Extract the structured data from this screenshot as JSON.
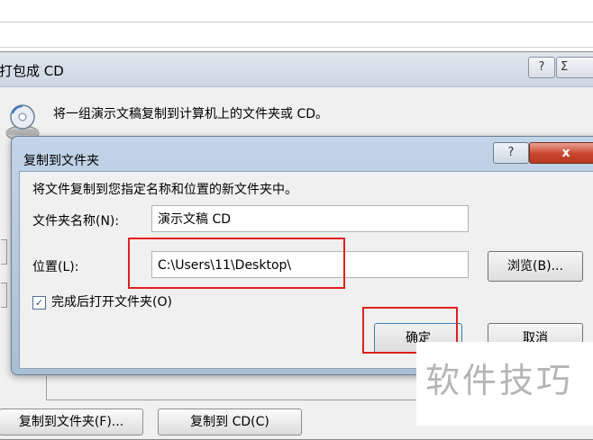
{
  "back_dialog": {
    "title": "打包成 CD",
    "help_label": "?",
    "close_label": "Σ",
    "description": "将一组演示文稿复制到计算机上的文件夹或 CD。",
    "copy_to_folder_button": "复制到文件夹(F)...",
    "copy_to_cd_button": "复制到 CD(C)"
  },
  "copy_dialog": {
    "title": "复制到文件夹",
    "help_label": "?",
    "close_label": "x",
    "description": "将文件复制到您指定名称和位置的新文件夹中。",
    "folder_name_label": "文件夹名称(N):",
    "folder_name_value": "演示文稿 CD",
    "location_label": "位置(L):",
    "location_value": "C:\\Users\\11\\Desktop\\",
    "browse_button": "浏览(B)...",
    "open_folder_label": "完成后打开文件夹(O)",
    "open_folder_checked": true,
    "check_mark": "✓",
    "ok_button": "确定",
    "cancel_button": "取消"
  },
  "watermark": "软件技巧",
  "colors": {
    "annotation_red": "#e0201c",
    "close_red": "#c8442d",
    "title_bar_blue": "#b5c9df"
  },
  "icons": [
    "cd-drive-icon",
    "help-icon",
    "close-icon",
    "checkbox-checked-icon"
  ]
}
